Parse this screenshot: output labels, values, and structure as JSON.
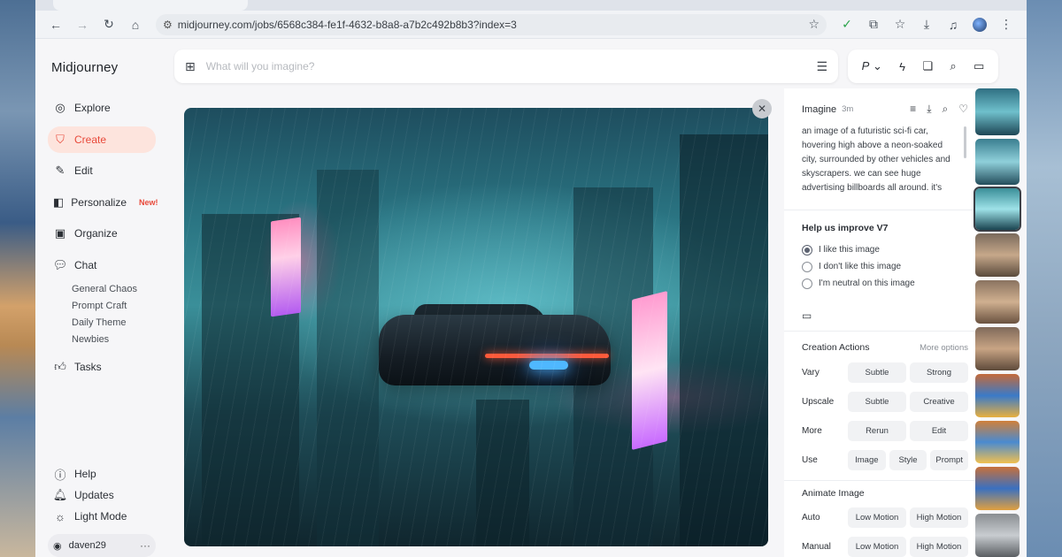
{
  "browser": {
    "url": "midjourney.com/jobs/6568c384-fe1f-4632-b8a8-a7b2c492b8b3?index=3"
  },
  "sidebar": {
    "brand": "Midjourney",
    "items": [
      {
        "label": "Explore",
        "icon": "compass-icon"
      },
      {
        "label": "Create",
        "icon": "brush-icon",
        "active": true
      },
      {
        "label": "Edit",
        "icon": "edit-icon"
      },
      {
        "label": "Personalize",
        "icon": "personalize-icon",
        "badge": "New!"
      },
      {
        "label": "Organize",
        "icon": "image-icon"
      },
      {
        "label": "Chat",
        "icon": "chat-icon"
      }
    ],
    "chat_rooms": [
      "General Chaos",
      "Prompt Craft",
      "Daily Theme",
      "Newbies"
    ],
    "tasks_label": "Tasks",
    "bottom": {
      "help": "Help",
      "updates": "Updates",
      "light_mode": "Light Mode",
      "username": "daven29"
    }
  },
  "prompt_bar": {
    "placeholder": "What will you imagine?",
    "tools_letter": "P"
  },
  "panel": {
    "title": "Imagine",
    "time": "3m",
    "prompt": "an image of a futuristic sci-fi car, hovering high above a neon-soaked city, surrounded by other vehicles and skyscrapers. we can see huge advertising billboards all around. it's",
    "feedback": {
      "title": "Help us improve V7",
      "options": [
        "I like this image",
        "I don't like this image",
        "I'm neutral on this image"
      ],
      "selected_index": 0
    },
    "creation": {
      "title": "Creation Actions",
      "more": "More options",
      "rows": [
        {
          "label": "Vary",
          "buttons": [
            "Subtle",
            "Strong"
          ]
        },
        {
          "label": "Upscale",
          "buttons": [
            "Subtle",
            "Creative"
          ]
        },
        {
          "label": "More",
          "buttons": [
            "Rerun",
            "Edit"
          ]
        },
        {
          "label": "Use",
          "buttons": [
            "Image",
            "Style",
            "Prompt"
          ]
        }
      ]
    },
    "animate": {
      "title": "Animate Image",
      "rows": [
        {
          "label": "Auto",
          "buttons": [
            "Low Motion",
            "High Motion"
          ]
        },
        {
          "label": "Manual",
          "buttons": [
            "Low Motion",
            "High Motion"
          ]
        }
      ]
    }
  },
  "colors": {
    "accent": "#e8493a",
    "active_bg": "#fde4dd"
  }
}
